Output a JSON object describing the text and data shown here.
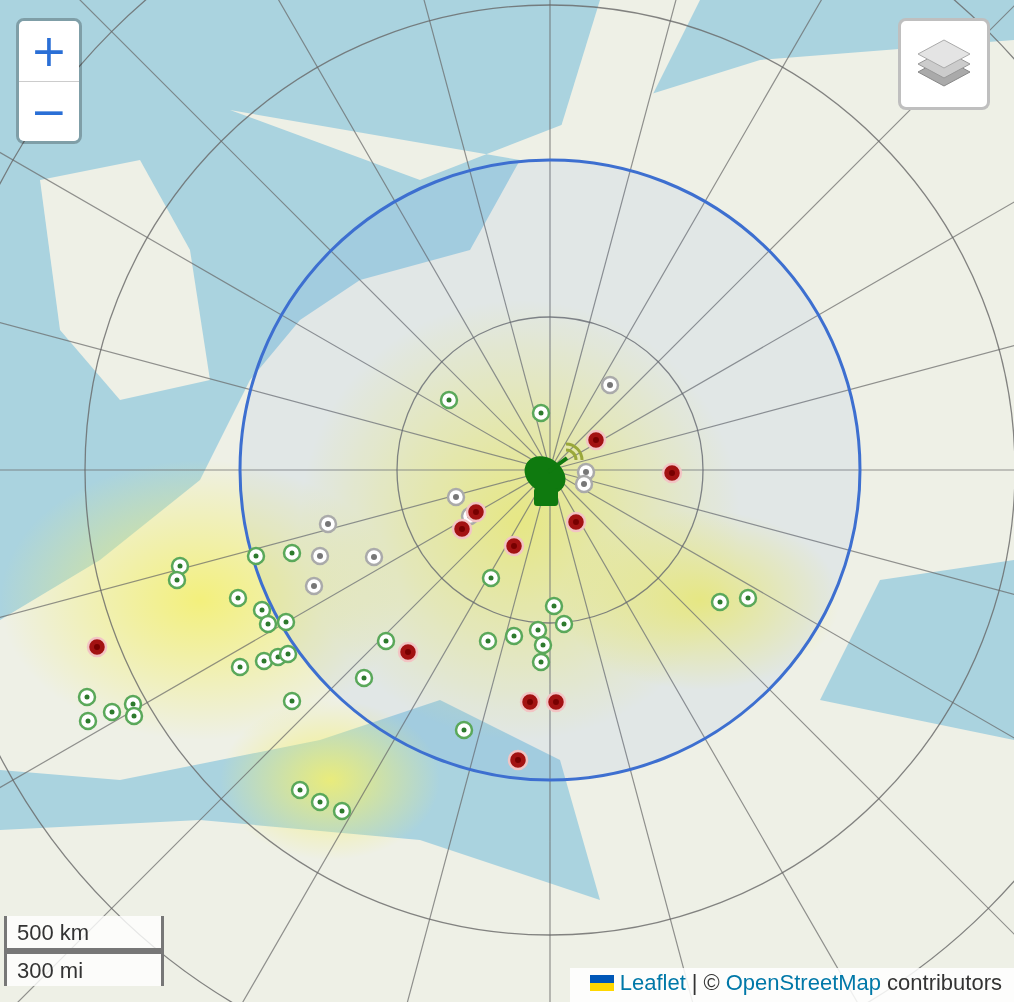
{
  "zoom_controls": {
    "zoom_in": "+",
    "zoom_out": "−"
  },
  "scale": [
    "500 km",
    "300 mi"
  ],
  "attribution": {
    "leaflet": "Leaflet",
    "separator": "|",
    "copyright": "©",
    "osm": "OpenStreetMap",
    "suffix": "contributors"
  }
}
